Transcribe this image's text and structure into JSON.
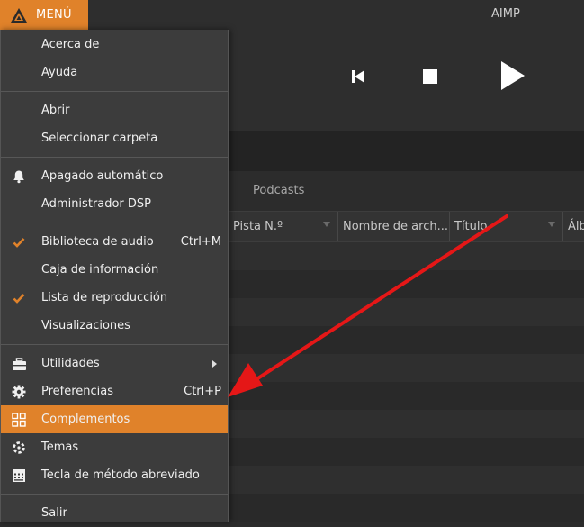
{
  "header": {
    "menu_label": "MENÚ",
    "app_title": "AIMP"
  },
  "tabs": {
    "podcasts": "Podcasts"
  },
  "columns": [
    "Pista N.º",
    "Nombre de arch...",
    "Título",
    "Álb"
  ],
  "menu": {
    "items": [
      {
        "label": "Acerca de",
        "shortcut": "",
        "icon": ""
      },
      {
        "label": "Ayuda",
        "shortcut": "",
        "icon": ""
      },
      {
        "label": "Abrir",
        "shortcut": "",
        "icon": ""
      },
      {
        "label": "Seleccionar carpeta",
        "shortcut": "",
        "icon": ""
      },
      {
        "label": "Apagado automático",
        "shortcut": "",
        "icon": "bell-icon"
      },
      {
        "label": "Administrador DSP",
        "shortcut": "",
        "icon": ""
      },
      {
        "label": "Biblioteca de audio",
        "shortcut": "Ctrl+M",
        "icon": "checkmark-icon"
      },
      {
        "label": "Caja de información",
        "shortcut": "",
        "icon": ""
      },
      {
        "label": "Lista de reproducción",
        "shortcut": "",
        "icon": "checkmark-icon"
      },
      {
        "label": "Visualizaciones",
        "shortcut": "",
        "icon": ""
      },
      {
        "label": "Utilidades",
        "shortcut": "",
        "icon": "toolbox-icon",
        "submenu": true
      },
      {
        "label": "Preferencias",
        "shortcut": "Ctrl+P",
        "icon": "gear-icon"
      },
      {
        "label": "Complementos",
        "shortcut": "",
        "icon": "plugins-icon",
        "highlighted": true
      },
      {
        "label": "Temas",
        "shortcut": "",
        "icon": "themes-icon"
      },
      {
        "label": "Tecla de método abreviado",
        "shortcut": "",
        "icon": "keyboard-icon"
      },
      {
        "label": "Salir",
        "shortcut": "",
        "icon": ""
      }
    ]
  },
  "colors": {
    "accent": "#e0822a",
    "annotation_arrow": "#e51717",
    "check": "#e0822a"
  }
}
